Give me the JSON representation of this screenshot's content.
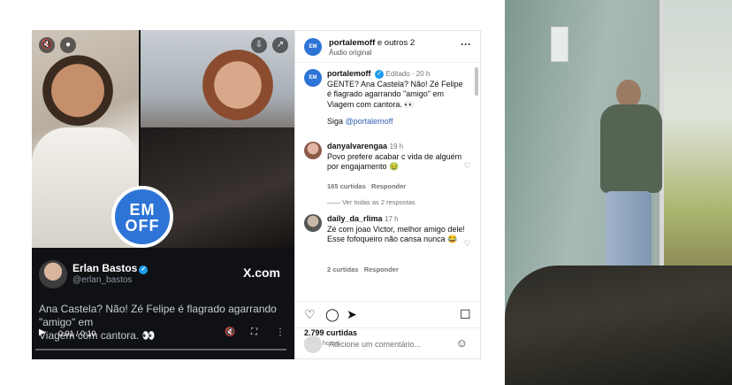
{
  "tweet": {
    "name": "Erlan Bastos",
    "handle": "@erlan_bastos",
    "brand": "X.com",
    "text_line1": "Ana Castela? Não! Zé Felipe é flagrado agarrando",
    "text_line2": "\"amigo\" em",
    "text_line3": "Viagem com cantora. 👀",
    "time": "0:01 / 0:10"
  },
  "overlay_badge": "EM\nOFF",
  "post": {
    "header_user": "portalemoff",
    "header_rest": " e outros 2",
    "audio": "Áudio original",
    "avatar_text": "EM OFF",
    "more_icon": "more-dots-icon"
  },
  "caption": {
    "user": "portalemoff",
    "meta": "Editado · 20 h",
    "text": "GENTE? Ana Castela? Não! Zé Felipe é flagrado agarrando \"amigo\" em Viagem com cantora. 👀",
    "follow_prefix": "Siga ",
    "follow_handle": "@portalemoff"
  },
  "comments": [
    {
      "user": "danyalvarengaa",
      "meta": "19 h",
      "text": "Povo prefere acabar c vida de alguém por engajamento 🤢",
      "likes": "165 curtidas",
      "reply": "Responder",
      "view_replies": "Ver todas as 2 respostas"
    },
    {
      "user": "daily_da_rlima",
      "meta": "17 h",
      "text": "Zé com joao Victor, melhor amigo dele! Esse fofoqueiro não cansa nunca 😂",
      "likes": "2 curtidas",
      "reply": "Responder"
    }
  ],
  "stats": {
    "likes": "2.799 curtidas",
    "ago": "há 20 horas"
  },
  "add_comment": {
    "placeholder": "Adicione um comentário..."
  },
  "icons": [
    "mute-icon",
    "user-icon",
    "download-icon",
    "share-out-icon",
    "heart-icon",
    "comment-icon",
    "send-icon",
    "bookmark-icon",
    "emoji-icon",
    "verified-icon",
    "fullscreen-icon",
    "more-vertical-icon"
  ],
  "colors": {
    "brand_blue": "#2d74d6",
    "link_blue": "#2f5fb0",
    "tweet_bg": "#0f1115",
    "verified": "#1d9bf0"
  }
}
